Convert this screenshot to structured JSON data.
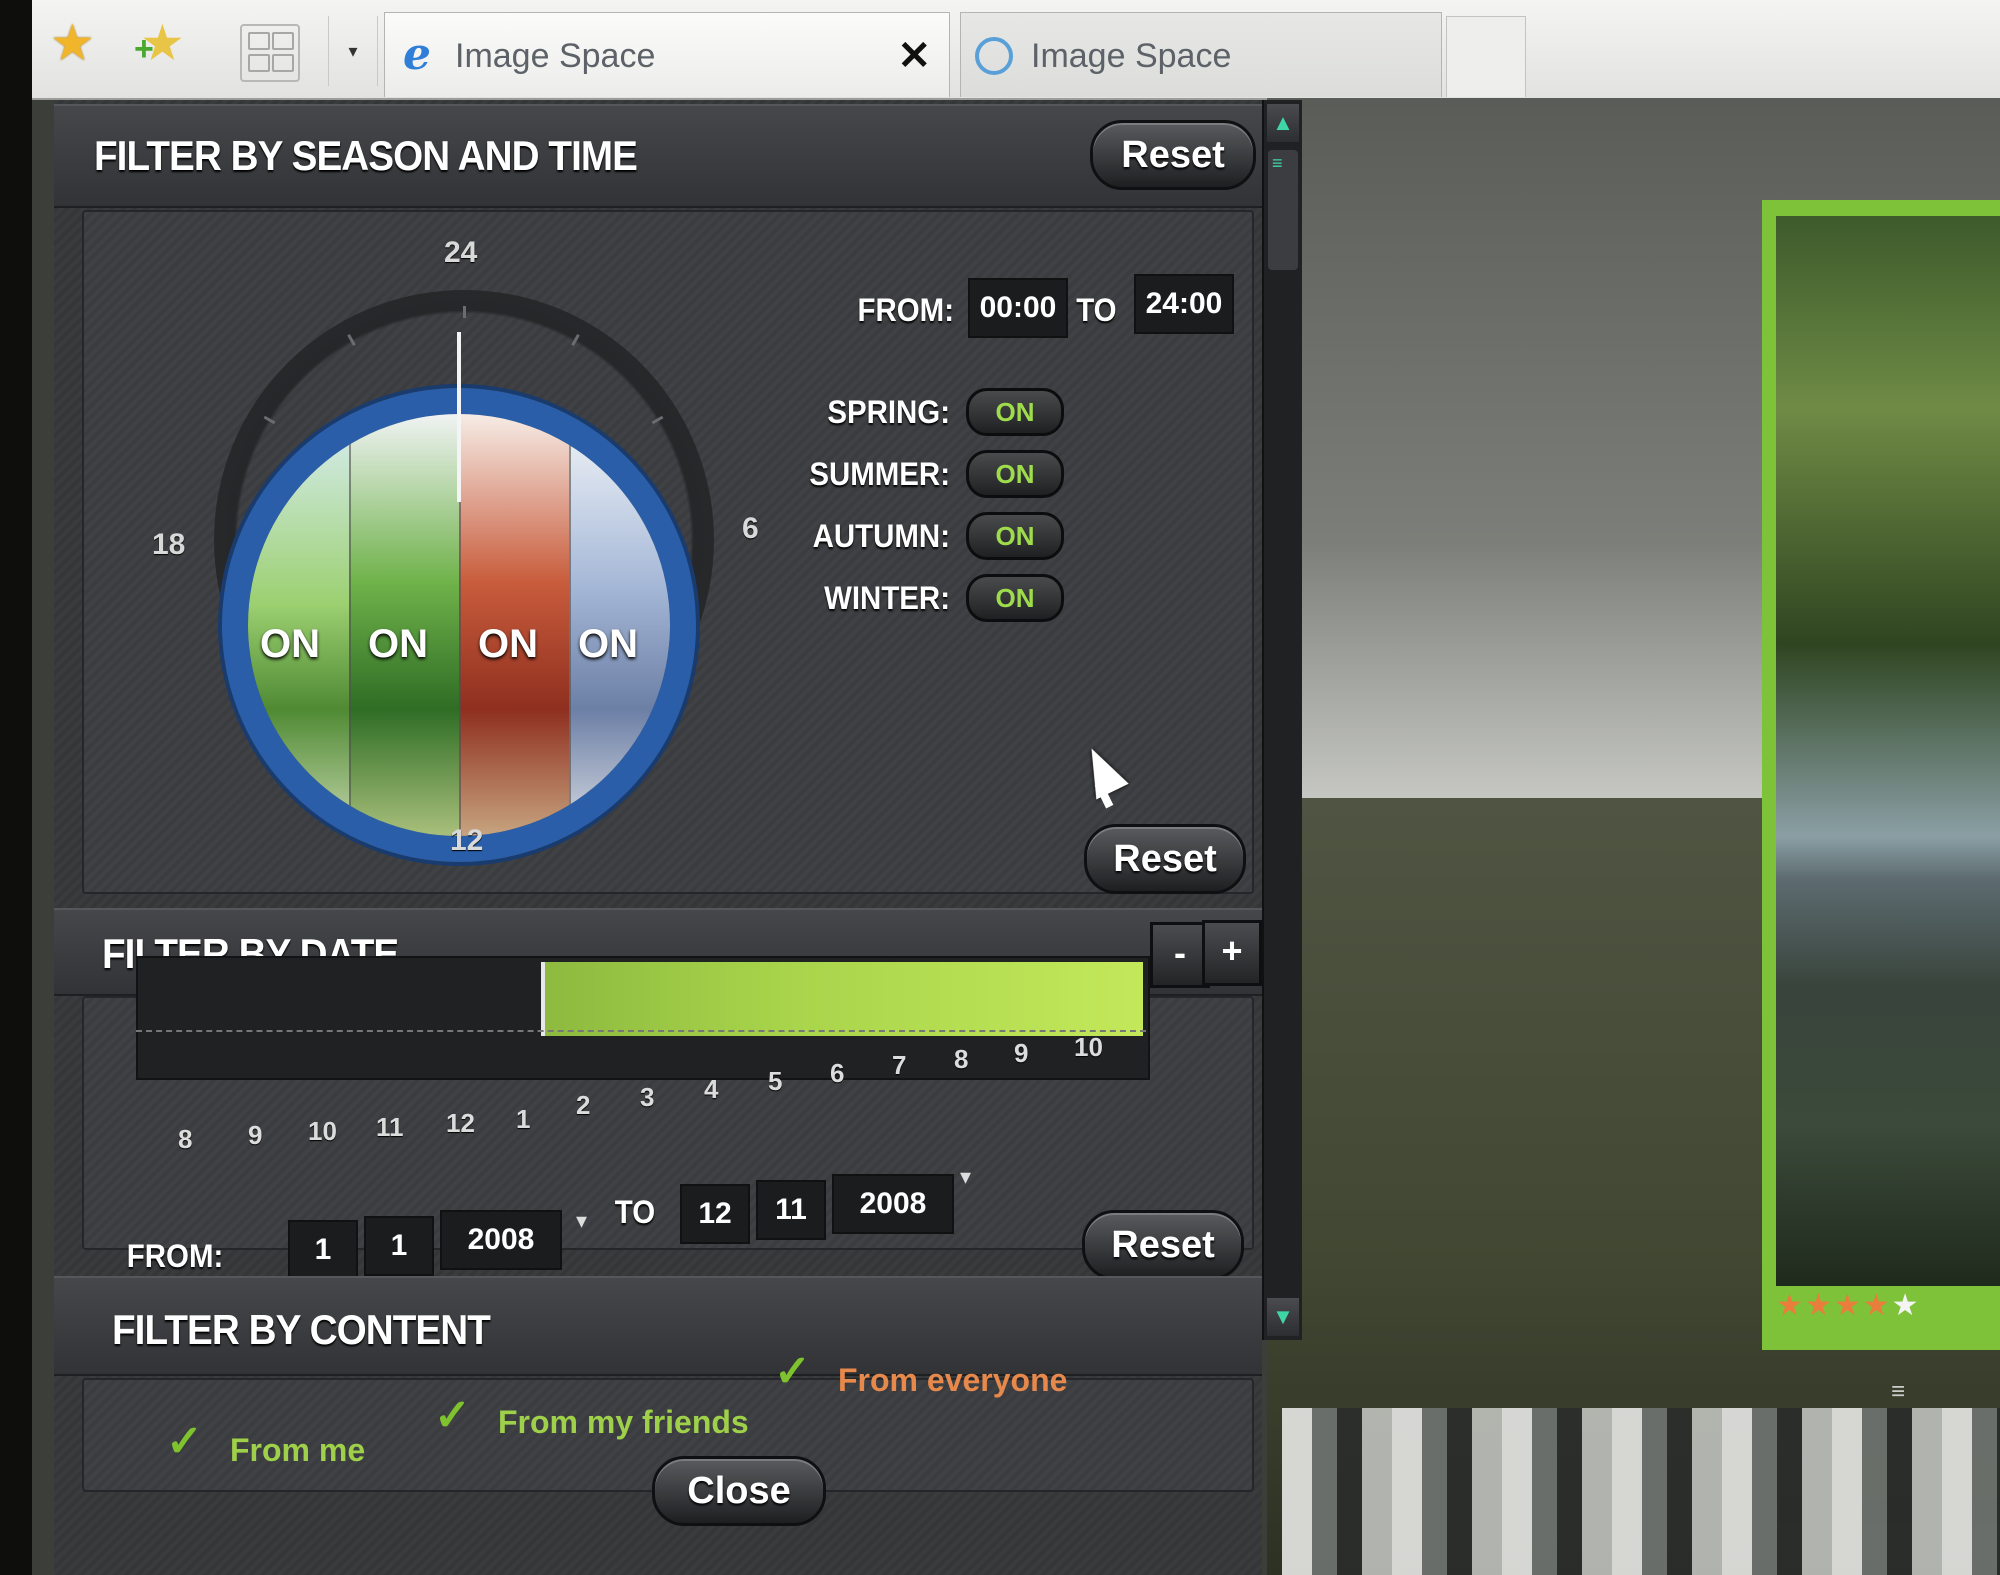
{
  "browser": {
    "tabs": [
      {
        "label": "Image Space",
        "close": "✕"
      },
      {
        "label": "Image Space"
      }
    ],
    "dropdown": "▾"
  },
  "season_time": {
    "title": "FILTER BY SEASON AND TIME",
    "reset_top": "Reset",
    "reset_bottom": "Reset",
    "hours": {
      "top": "24",
      "right": "6",
      "bottom": "12",
      "left": "18"
    },
    "wedges": [
      "ON",
      "ON",
      "ON",
      "ON"
    ],
    "from_label": "FROM:",
    "from_value": "00:00",
    "to_label": "TO",
    "to_value": "24:00",
    "seasons": [
      {
        "label": "SPRING:",
        "state": "ON"
      },
      {
        "label": "SUMMER:",
        "state": "ON"
      },
      {
        "label": "AUTUMN:",
        "state": "ON"
      },
      {
        "label": "WINTER:",
        "state": "ON"
      }
    ]
  },
  "date": {
    "title": "FILTER BY DATE",
    "zoom_out": "-",
    "zoom_in": "+",
    "months_prev": [
      "8",
      "9",
      "10",
      "11",
      "12"
    ],
    "months_lower": [
      "1"
    ],
    "months_upper": [
      "2",
      "3",
      "4",
      "5",
      "6",
      "7",
      "8",
      "9",
      "10"
    ],
    "selection_fraction": 0.59,
    "from_label": "FROM:",
    "from": {
      "day": "1",
      "month": "1",
      "year": "2008"
    },
    "to_label": "TO",
    "to": {
      "day": "12",
      "month": "11",
      "year": "2008"
    },
    "reset": "Reset"
  },
  "content": {
    "title": "FILTER BY CONTENT",
    "options": [
      {
        "label": "From me",
        "checked": true,
        "color": "#9ed04a"
      },
      {
        "label": "From my friends",
        "checked": true,
        "color": "#9ed04a"
      },
      {
        "label": "From everyone",
        "checked": true,
        "color": "#e8894c"
      }
    ],
    "close": "Close"
  },
  "viewer": {
    "rating": 4,
    "rating_max": 5,
    "accent": "#7ec23a"
  }
}
